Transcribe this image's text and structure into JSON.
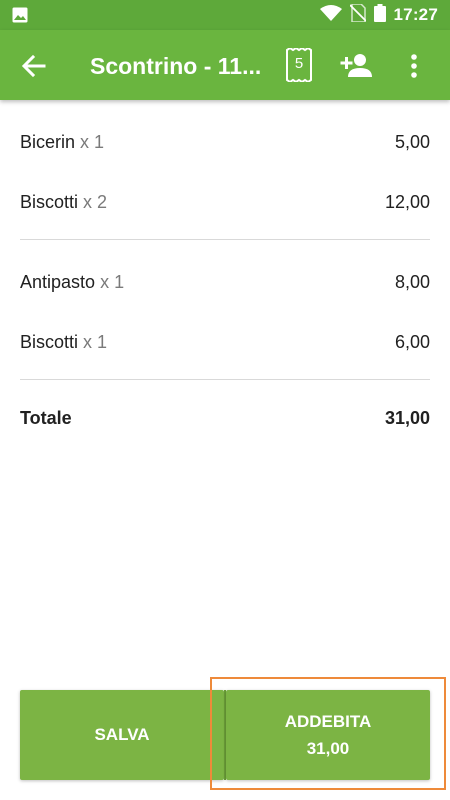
{
  "status_bar": {
    "time": "17:27"
  },
  "app_bar": {
    "title": "Scontrino - 11...",
    "receipt_badge": "5",
    "icons": [
      "back-arrow-icon",
      "receipt-icon",
      "add-person-icon",
      "more-vert-icon"
    ]
  },
  "groups": [
    {
      "items": [
        {
          "name": "Bicerin",
          "qty": "x 1",
          "price": "5,00"
        },
        {
          "name": "Biscotti",
          "qty": "x 2",
          "price": "12,00"
        }
      ]
    },
    {
      "items": [
        {
          "name": "Antipasto",
          "qty": "x 1",
          "price": "8,00"
        },
        {
          "name": "Biscotti",
          "qty": "x 1",
          "price": "6,00"
        }
      ]
    }
  ],
  "total": {
    "label": "Totale",
    "value": "31,00"
  },
  "buttons": {
    "save_label": "SALVA",
    "charge_label": "ADDEBITA",
    "charge_amount": "31,00"
  },
  "colors": {
    "status_bar": "#5ea93a",
    "app_bar": "#6ab53f",
    "button": "#7cb444",
    "highlight": "#ee8a3a"
  }
}
